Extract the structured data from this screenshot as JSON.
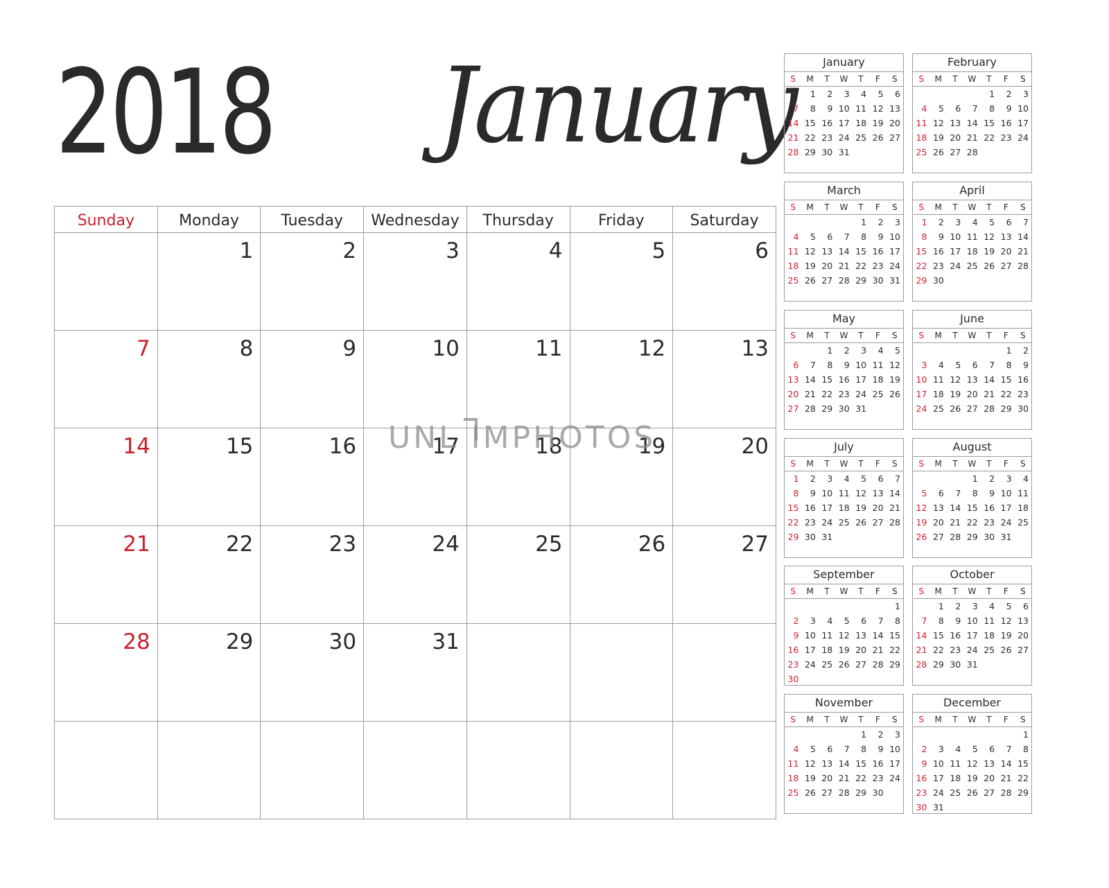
{
  "header": {
    "year": "2018",
    "month": "January"
  },
  "colors": {
    "accent_red": "#cc1f2e",
    "text": "#2a2a2a",
    "grid": "#9a9a9a"
  },
  "main_calendar": {
    "weekdays": [
      "Sunday",
      "Monday",
      "Tuesday",
      "Wednesday",
      "Thursday",
      "Friday",
      "Saturday"
    ],
    "weeks": [
      [
        "",
        "1",
        "2",
        "3",
        "4",
        "5",
        "6"
      ],
      [
        "7",
        "8",
        "9",
        "10",
        "11",
        "12",
        "13"
      ],
      [
        "14",
        "15",
        "16",
        "17",
        "18",
        "19",
        "20"
      ],
      [
        "21",
        "22",
        "23",
        "24",
        "25",
        "26",
        "27"
      ],
      [
        "28",
        "29",
        "30",
        "31",
        "",
        "",
        ""
      ],
      [
        "",
        "",
        "",
        "",
        "",
        "",
        ""
      ]
    ]
  },
  "mini_weekdays": [
    "S",
    "M",
    "T",
    "W",
    "T",
    "F",
    "S"
  ],
  "mini_calendars": [
    {
      "name": "January",
      "weeks": [
        [
          "",
          "1",
          "2",
          "3",
          "4",
          "5",
          "6"
        ],
        [
          "7",
          "8",
          "9",
          "10",
          "11",
          "12",
          "13"
        ],
        [
          "14",
          "15",
          "16",
          "17",
          "18",
          "19",
          "20"
        ],
        [
          "21",
          "22",
          "23",
          "24",
          "25",
          "26",
          "27"
        ],
        [
          "28",
          "29",
          "30",
          "31",
          "",
          "",
          ""
        ],
        [
          "",
          "",
          "",
          "",
          "",
          "",
          ""
        ]
      ]
    },
    {
      "name": "February",
      "weeks": [
        [
          "",
          "",
          "",
          "",
          "1",
          "2",
          "3"
        ],
        [
          "4",
          "5",
          "6",
          "7",
          "8",
          "9",
          "10"
        ],
        [
          "11",
          "12",
          "13",
          "14",
          "15",
          "16",
          "17"
        ],
        [
          "18",
          "19",
          "20",
          "21",
          "22",
          "23",
          "24"
        ],
        [
          "25",
          "26",
          "27",
          "28",
          "",
          "",
          ""
        ],
        [
          "",
          "",
          "",
          "",
          "",
          "",
          ""
        ]
      ]
    },
    {
      "name": "March",
      "weeks": [
        [
          "",
          "",
          "",
          "",
          "1",
          "2",
          "3"
        ],
        [
          "4",
          "5",
          "6",
          "7",
          "8",
          "9",
          "10"
        ],
        [
          "11",
          "12",
          "13",
          "14",
          "15",
          "16",
          "17"
        ],
        [
          "18",
          "19",
          "20",
          "21",
          "22",
          "23",
          "24"
        ],
        [
          "25",
          "26",
          "27",
          "28",
          "29",
          "30",
          "31"
        ],
        [
          "",
          "",
          "",
          "",
          "",
          "",
          ""
        ]
      ]
    },
    {
      "name": "April",
      "weeks": [
        [
          "1",
          "2",
          "3",
          "4",
          "5",
          "6",
          "7"
        ],
        [
          "8",
          "9",
          "10",
          "11",
          "12",
          "13",
          "14"
        ],
        [
          "15",
          "16",
          "17",
          "18",
          "19",
          "20",
          "21"
        ],
        [
          "22",
          "23",
          "24",
          "25",
          "26",
          "27",
          "28"
        ],
        [
          "29",
          "30",
          "",
          "",
          "",
          "",
          ""
        ],
        [
          "",
          "",
          "",
          "",
          "",
          "",
          ""
        ]
      ]
    },
    {
      "name": "May",
      "weeks": [
        [
          "",
          "",
          "1",
          "2",
          "3",
          "4",
          "5"
        ],
        [
          "6",
          "7",
          "8",
          "9",
          "10",
          "11",
          "12"
        ],
        [
          "13",
          "14",
          "15",
          "16",
          "17",
          "18",
          "19"
        ],
        [
          "20",
          "21",
          "22",
          "23",
          "24",
          "25",
          "26"
        ],
        [
          "27",
          "28",
          "29",
          "30",
          "31",
          "",
          ""
        ],
        [
          "",
          "",
          "",
          "",
          "",
          "",
          ""
        ]
      ]
    },
    {
      "name": "June",
      "weeks": [
        [
          "",
          "",
          "",
          "",
          "",
          "1",
          "2"
        ],
        [
          "3",
          "4",
          "5",
          "6",
          "7",
          "8",
          "9"
        ],
        [
          "10",
          "11",
          "12",
          "13",
          "14",
          "15",
          "16"
        ],
        [
          "17",
          "18",
          "19",
          "20",
          "21",
          "22",
          "23"
        ],
        [
          "24",
          "25",
          "26",
          "27",
          "28",
          "29",
          "30"
        ],
        [
          "",
          "",
          "",
          "",
          "",
          "",
          ""
        ]
      ]
    },
    {
      "name": "July",
      "weeks": [
        [
          "1",
          "2",
          "3",
          "4",
          "5",
          "6",
          "7"
        ],
        [
          "8",
          "9",
          "10",
          "11",
          "12",
          "13",
          "14"
        ],
        [
          "15",
          "16",
          "17",
          "18",
          "19",
          "20",
          "21"
        ],
        [
          "22",
          "23",
          "24",
          "25",
          "26",
          "27",
          "28"
        ],
        [
          "29",
          "30",
          "31",
          "",
          "",
          "",
          ""
        ],
        [
          "",
          "",
          "",
          "",
          "",
          "",
          ""
        ]
      ]
    },
    {
      "name": "August",
      "weeks": [
        [
          "",
          "",
          "",
          "1",
          "2",
          "3",
          "4"
        ],
        [
          "5",
          "6",
          "7",
          "8",
          "9",
          "10",
          "11"
        ],
        [
          "12",
          "13",
          "14",
          "15",
          "16",
          "17",
          "18"
        ],
        [
          "19",
          "20",
          "21",
          "22",
          "23",
          "24",
          "25"
        ],
        [
          "26",
          "27",
          "28",
          "29",
          "30",
          "31",
          ""
        ],
        [
          "",
          "",
          "",
          "",
          "",
          "",
          ""
        ]
      ]
    },
    {
      "name": "September",
      "weeks": [
        [
          "",
          "",
          "",
          "",
          "",
          "",
          "1"
        ],
        [
          "2",
          "3",
          "4",
          "5",
          "6",
          "7",
          "8"
        ],
        [
          "9",
          "10",
          "11",
          "12",
          "13",
          "14",
          "15"
        ],
        [
          "16",
          "17",
          "18",
          "19",
          "20",
          "21",
          "22"
        ],
        [
          "23",
          "24",
          "25",
          "26",
          "27",
          "28",
          "29"
        ],
        [
          "30",
          "",
          "",
          "",
          "",
          "",
          ""
        ]
      ]
    },
    {
      "name": "October",
      "weeks": [
        [
          "",
          "1",
          "2",
          "3",
          "4",
          "5",
          "6"
        ],
        [
          "7",
          "8",
          "9",
          "10",
          "11",
          "12",
          "13"
        ],
        [
          "14",
          "15",
          "16",
          "17",
          "18",
          "19",
          "20"
        ],
        [
          "21",
          "22",
          "23",
          "24",
          "25",
          "26",
          "27"
        ],
        [
          "28",
          "29",
          "30",
          "31",
          "",
          "",
          ""
        ],
        [
          "",
          "",
          "",
          "",
          "",
          "",
          ""
        ]
      ]
    },
    {
      "name": "November",
      "weeks": [
        [
          "",
          "",
          "",
          "",
          "1",
          "2",
          "3"
        ],
        [
          "4",
          "5",
          "6",
          "7",
          "8",
          "9",
          "10"
        ],
        [
          "11",
          "12",
          "13",
          "14",
          "15",
          "16",
          "17"
        ],
        [
          "18",
          "19",
          "20",
          "21",
          "22",
          "23",
          "24"
        ],
        [
          "25",
          "26",
          "27",
          "28",
          "29",
          "30",
          ""
        ],
        [
          "",
          "",
          "",
          "",
          "",
          "",
          ""
        ]
      ]
    },
    {
      "name": "December",
      "weeks": [
        [
          "",
          "",
          "",
          "",
          "",
          "",
          "1"
        ],
        [
          "2",
          "3",
          "4",
          "5",
          "6",
          "7",
          "8"
        ],
        [
          "9",
          "10",
          "11",
          "12",
          "13",
          "14",
          "15"
        ],
        [
          "16",
          "17",
          "18",
          "19",
          "20",
          "21",
          "22"
        ],
        [
          "23",
          "24",
          "25",
          "26",
          "27",
          "28",
          "29"
        ],
        [
          "30",
          "31",
          "",
          "",
          "",
          "",
          ""
        ]
      ]
    }
  ],
  "watermark": {
    "text": "UNL IMPHOTOS"
  }
}
